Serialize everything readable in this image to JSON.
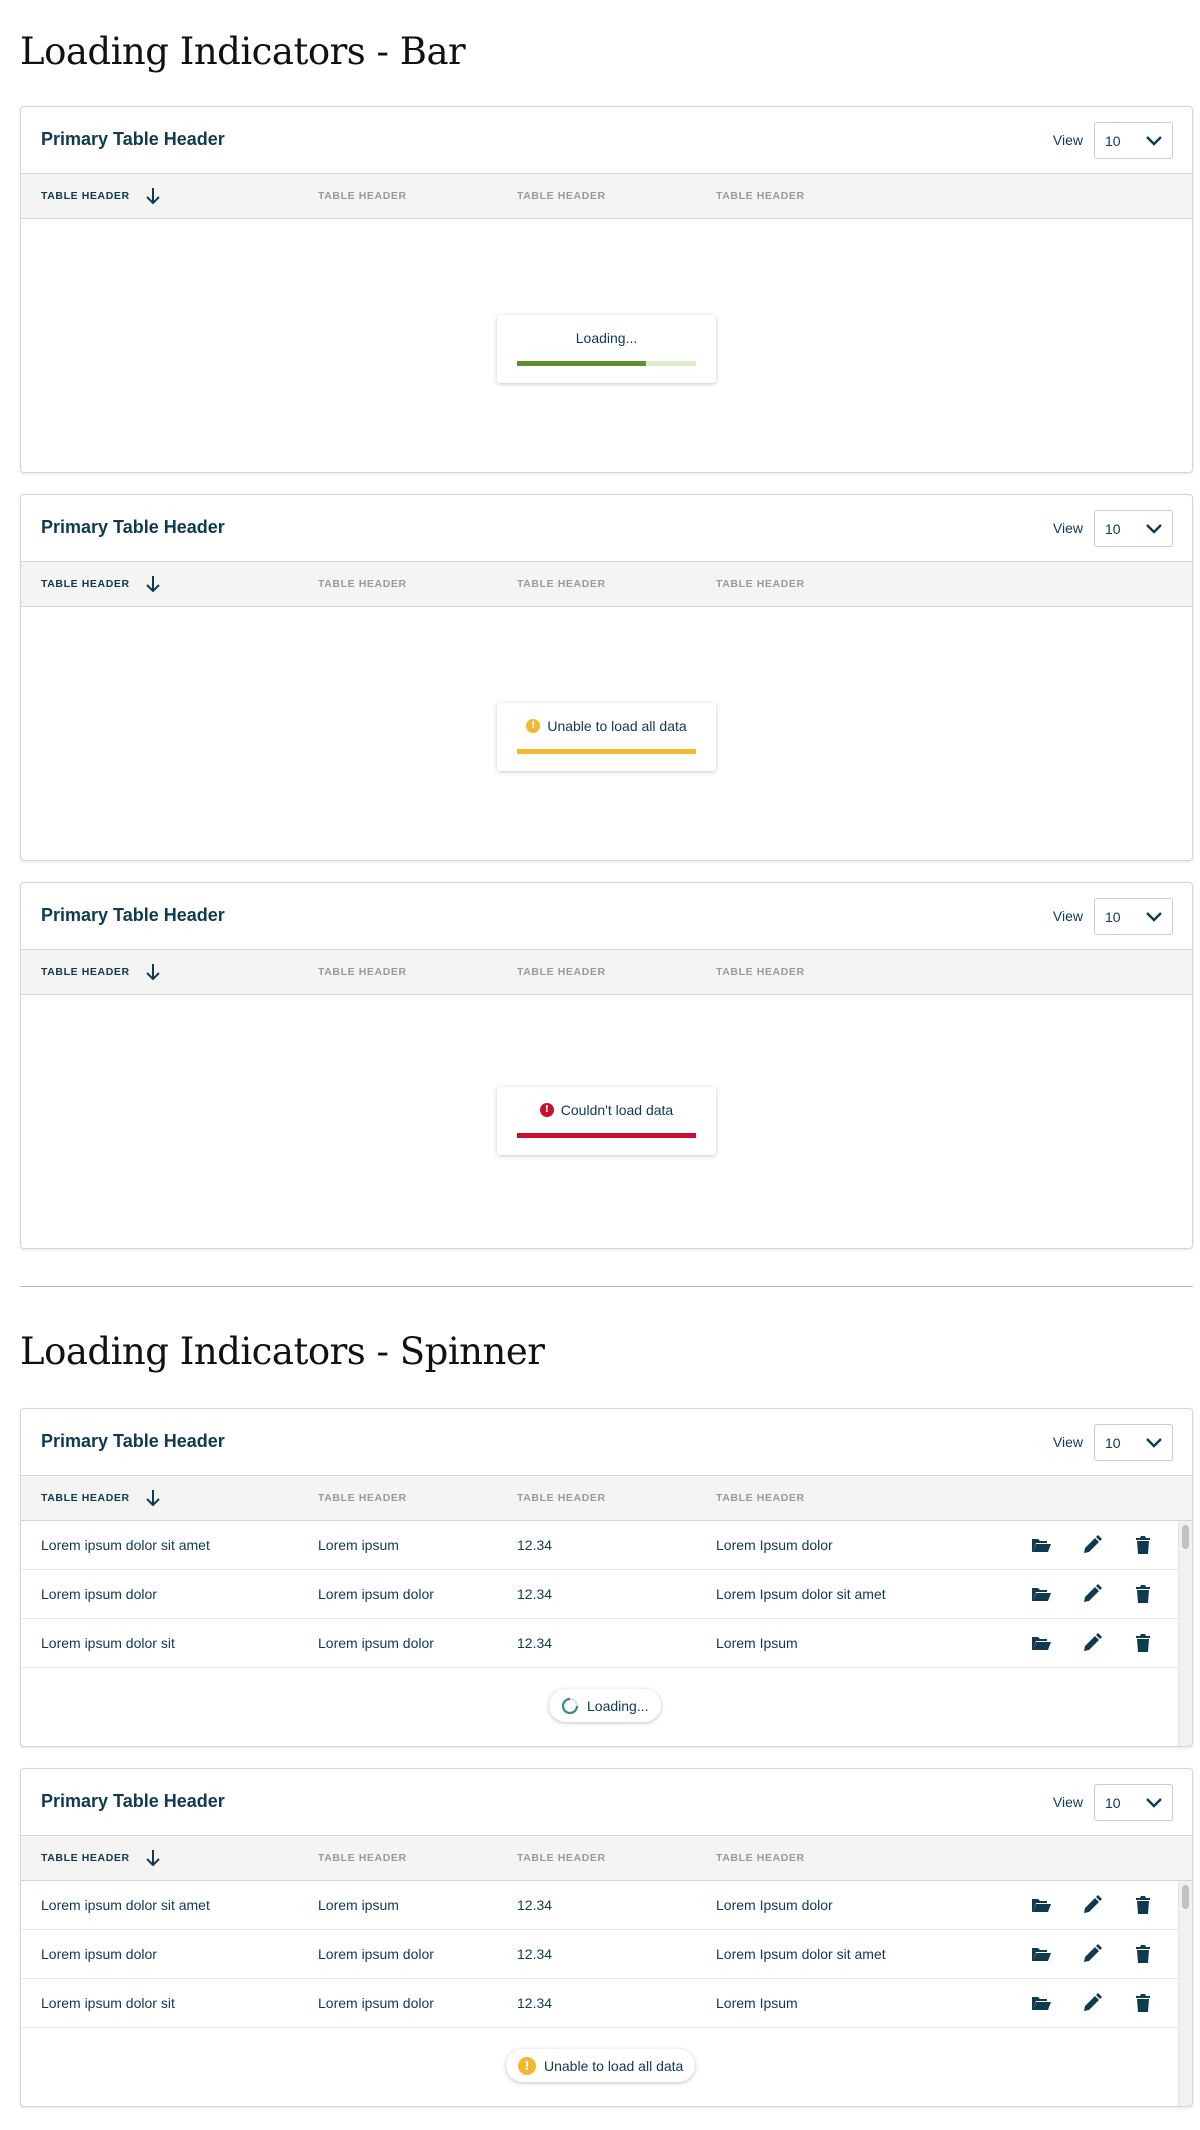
{
  "section_bar": {
    "title": "Loading Indicators - Bar"
  },
  "section_spinner": {
    "title": "Loading Indicators - Spinner"
  },
  "table": {
    "title": "Primary Table Header",
    "view_label": "View",
    "view_value": "10",
    "headers": [
      "TABLE HEADER",
      "TABLE HEADER",
      "TABLE HEADER",
      "TABLE HEADER"
    ]
  },
  "bar_states": [
    {
      "message": "Loading...",
      "progress": 0.72,
      "color": "#5e8f2e",
      "track": "#dcebc8"
    },
    {
      "message": "Unable to load all data",
      "progress": 1.0,
      "color": "#f5b731",
      "icon": "warning-icon"
    },
    {
      "message": "Couldn't load data",
      "progress": 1.0,
      "color": "#c8102e",
      "icon": "error-icon"
    }
  ],
  "rows": [
    [
      "Lorem ipsum dolor sit amet",
      "Lorem ipsum",
      "12.34",
      "Lorem Ipsum dolor"
    ],
    [
      "Lorem ipsum dolor",
      "Lorem ipsum dolor",
      "12.34",
      "Lorem Ipsum dolor sit amet"
    ],
    [
      "Lorem ipsum dolor sit",
      "Lorem ipsum dolor",
      "12.34",
      "Lorem Ipsum"
    ]
  ],
  "spinner_states": [
    {
      "message": "Loading...",
      "icon": "spinner-icon"
    },
    {
      "message": "Unable to load all data",
      "icon": "warning-icon"
    }
  ],
  "colors": {
    "text": "#0f3a4f",
    "header_bg": "#f4f4f2",
    "warning": "#f5b731",
    "error": "#c8102e",
    "success": "#5e8f2e"
  }
}
